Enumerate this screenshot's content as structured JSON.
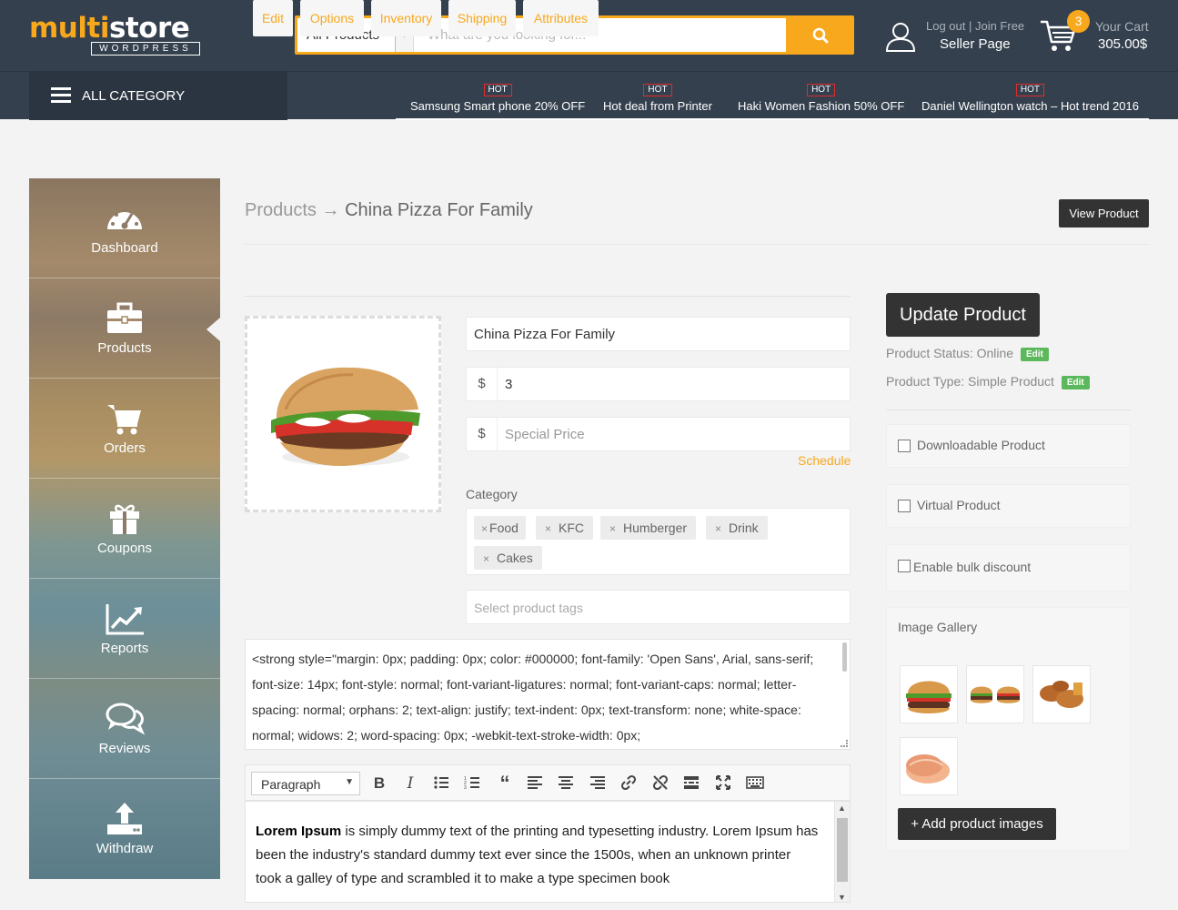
{
  "header": {
    "logo_main_a": "multi",
    "logo_main_b": "store",
    "logo_sub": "WORDPRESS",
    "search_category": "All Products",
    "search_placeholder": "What are you looking for...",
    "user_links": "Log out | Join Free",
    "seller_page": "Seller Page",
    "cart_count": "3",
    "cart_label": "Your Cart",
    "cart_total": "305.00$"
  },
  "nav": {
    "all_category": "ALL CATEGORY",
    "promos": [
      {
        "badge": "HOT",
        "text": "Samsung Smart phone 20% OFF"
      },
      {
        "badge": "HOT",
        "text": "Hot deal from Printer"
      },
      {
        "badge": "HOT",
        "text": "Haki Women Fashion 50% OFF"
      },
      {
        "badge": "HOT",
        "text": "Daniel Wellington watch – Hot trend 2016"
      }
    ]
  },
  "sidebar": {
    "items": [
      {
        "label": "Dashboard",
        "icon": "dashboard-icon"
      },
      {
        "label": "Products",
        "icon": "briefcase-icon"
      },
      {
        "label": "Orders",
        "icon": "cart-icon"
      },
      {
        "label": "Coupons",
        "icon": "gift-icon"
      },
      {
        "label": "Reports",
        "icon": "chart-icon"
      },
      {
        "label": "Reviews",
        "icon": "chat-icon"
      },
      {
        "label": "Withdraw",
        "icon": "upload-icon"
      }
    ]
  },
  "main": {
    "breadcrumb_root": "Products",
    "breadcrumb_arrow": "→",
    "breadcrumb_current": "China Pizza For Family",
    "view_product": "View Product",
    "tabs": [
      "Edit",
      "Options",
      "Inventory",
      "Shipping",
      "Attributes"
    ],
    "product_name": "China Pizza For Family",
    "currency": "$",
    "price": "3",
    "special_price_placeholder": "Special Price",
    "schedule": "Schedule",
    "category_label": "Category",
    "categories": [
      "Food",
      "KFC",
      "Humberger",
      "Drink",
      "Cakes"
    ],
    "tags_placeholder": "Select product tags",
    "code_text": "<strong style=\"margin: 0px; padding: 0px; color: #000000; font-family: 'Open Sans', Arial, sans-serif; font-size: 14px; font-style: normal; font-variant-ligatures: normal; font-variant-caps: normal; letter-spacing: normal; orphans: 2; text-align: justify; text-indent: 0px; text-transform: none; white-space: normal; widows: 2; word-spacing: 0px; -webkit-text-stroke-width: 0px;",
    "editor_format": "Paragraph",
    "editor_bold": "Lorem Ipsum",
    "editor_text": " is simply dummy text of the printing and typesetting industry. Lorem Ipsum has been the industry's standard dummy text ever since the 1500s, when an unknown printer took a galley of type and scrambled it to make a type specimen book"
  },
  "right": {
    "update_button": "Update Product",
    "status_label": "Product Status: Online",
    "type_label": "Product Type: Simple Product",
    "edit_badge": "Edit",
    "checkbox_downloadable": "Downloadable Product",
    "checkbox_virtual": "Virtual Product",
    "checkbox_bulk": "Enable bulk discount",
    "gallery_title": "Image Gallery",
    "add_images_button": "+ Add product images"
  },
  "colors": {
    "accent": "#f8a81d",
    "header_bg": "#34404e",
    "dark_button": "#333333",
    "hot_border": "#e02b2b",
    "edit_badge": "#5cb85c"
  }
}
